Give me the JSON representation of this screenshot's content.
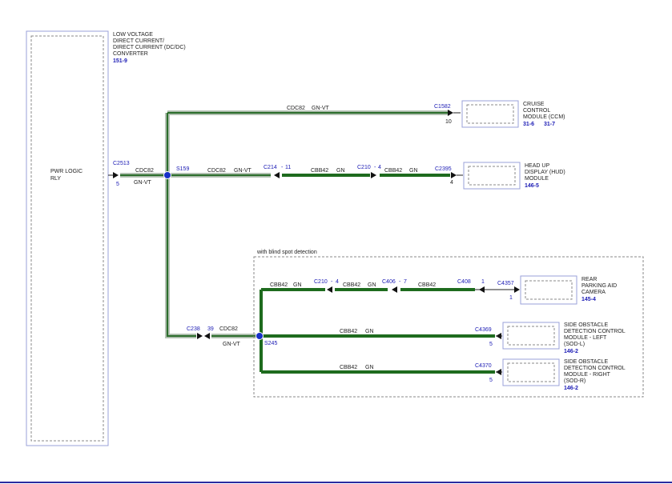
{
  "converter": {
    "title_lines": [
      "LOW VOLTAGE",
      "DIRECT CURRENT/",
      "DIRECT CURRENT (DC/DC)",
      "CONVERTER"
    ],
    "ref": "151-9",
    "inner_label_lines": [
      "PWR LOGIC",
      "RLY"
    ],
    "connector": "C2513",
    "pin": "5",
    "circuit": "CDC82",
    "color": "GN-VT"
  },
  "splice_s159": "S159",
  "splice_s245": "S245",
  "wire_top": {
    "circuit": "CDC82",
    "color": "GN-VT"
  },
  "ccm": {
    "lines": [
      "CRUISE",
      "CONTROL",
      "MODULE (CCM)"
    ],
    "refs": [
      "31-6",
      "31-7"
    ],
    "connector": "C1582",
    "pin": "10"
  },
  "hud_row": {
    "seg1_circuit": "CDC82",
    "seg1_color": "GN-VT",
    "c214": "C214",
    "c214_pin": "11",
    "seg2_circuit": "CBB42",
    "seg2_color": "GN",
    "c210": "C210",
    "c210_pin": "4",
    "seg3_circuit": "CBB42",
    "seg3_color": "GN",
    "connector": "C2395",
    "pin": "4"
  },
  "hud": {
    "lines": [
      "HEAD UP",
      "DISPLAY (HUD)",
      "MODULE"
    ],
    "ref": "146-5"
  },
  "blind_spot_label": "with blind spot detection",
  "c238_row": {
    "connector": "C238",
    "pin": "39",
    "circuit": "CDC82",
    "color": "GN-VT"
  },
  "camera_row": {
    "seg1_circuit": "CBB42",
    "seg1_color": "GN",
    "c210": "C210",
    "c210_pin": "4",
    "seg2_circuit": "CBB42",
    "seg2_color": "GN",
    "c406": "C406",
    "c406_pin": "7",
    "seg3_circuit": "CBB42",
    "c408": "C408",
    "c408_pin": "1",
    "connector": "C4357",
    "pin": "1"
  },
  "camera": {
    "lines": [
      "REAR",
      "PARKING AID",
      "CAMERA"
    ],
    "ref": "145-4"
  },
  "sodl_row": {
    "circuit": "CBB42",
    "color": "GN",
    "connector": "C4369",
    "pin": "5"
  },
  "sodl": {
    "lines": [
      "SIDE OBSTACLE",
      "DETECTION CONTROL",
      "MODULE - LEFT",
      "(SOD-L)"
    ],
    "ref": "146-2"
  },
  "sodr_row": {
    "circuit": "CBB42",
    "color": "GN",
    "connector": "C4370",
    "pin": "5"
  },
  "sodr": {
    "lines": [
      "SIDE OBSTACLE",
      "DETECTION CONTROL",
      "MODULE - RIGHT",
      "(SOD-R)"
    ],
    "ref": "146-2"
  },
  "colors": {
    "wire": "#1e6b1e",
    "splice": "#1730c8",
    "reference": "#1a1ab4",
    "module_border": "#9aa0d8",
    "footer_rule": "#2a2aa0"
  }
}
